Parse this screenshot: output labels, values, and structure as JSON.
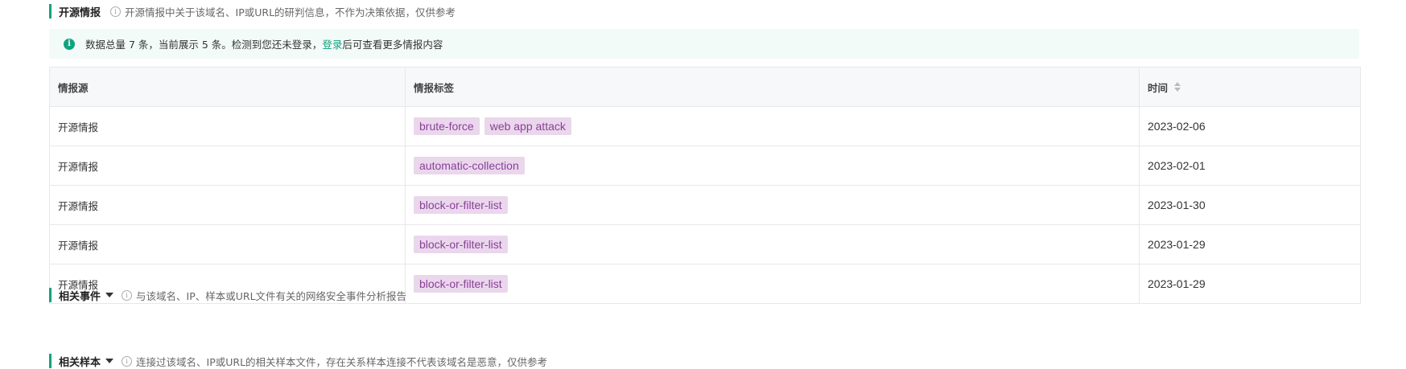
{
  "sections": {
    "intel": {
      "title": "开源情报",
      "desc": "开源情报中关于该域名、IP或URL的研判信息，不作为决策依据，仅供参考"
    },
    "events": {
      "title": "相关事件",
      "desc": "与该域名、IP、样本或URL文件有关的网络安全事件分析报告"
    },
    "samples": {
      "title": "相关样本",
      "desc": "连接过该域名、IP或URL的相关样本文件，存在关系样本连接不代表该域名是恶意，仅供参考"
    }
  },
  "notice": {
    "prefix": "数据总量 7 条，当前展示 5 条。检测到您还未登录，",
    "link": "登录",
    "suffix": "后可查看更多情报内容"
  },
  "table": {
    "headers": [
      "情报源",
      "情报标签",
      "时间"
    ],
    "rows": [
      {
        "source": "开源情报",
        "tags": [
          "brute-force",
          "web app attack"
        ],
        "date": "2023-02-06"
      },
      {
        "source": "开源情报",
        "tags": [
          "automatic-collection"
        ],
        "date": "2023-02-01"
      },
      {
        "source": "开源情报",
        "tags": [
          "block-or-filter-list"
        ],
        "date": "2023-01-30"
      },
      {
        "source": "开源情报",
        "tags": [
          "block-or-filter-list"
        ],
        "date": "2023-01-29"
      },
      {
        "source": "开源情报",
        "tags": [
          "block-or-filter-list"
        ],
        "date": "2023-01-29"
      }
    ]
  },
  "colors": {
    "accent": "#10a37f",
    "tag_bg": "#ead7ec",
    "tag_text": "#8a3f98"
  }
}
